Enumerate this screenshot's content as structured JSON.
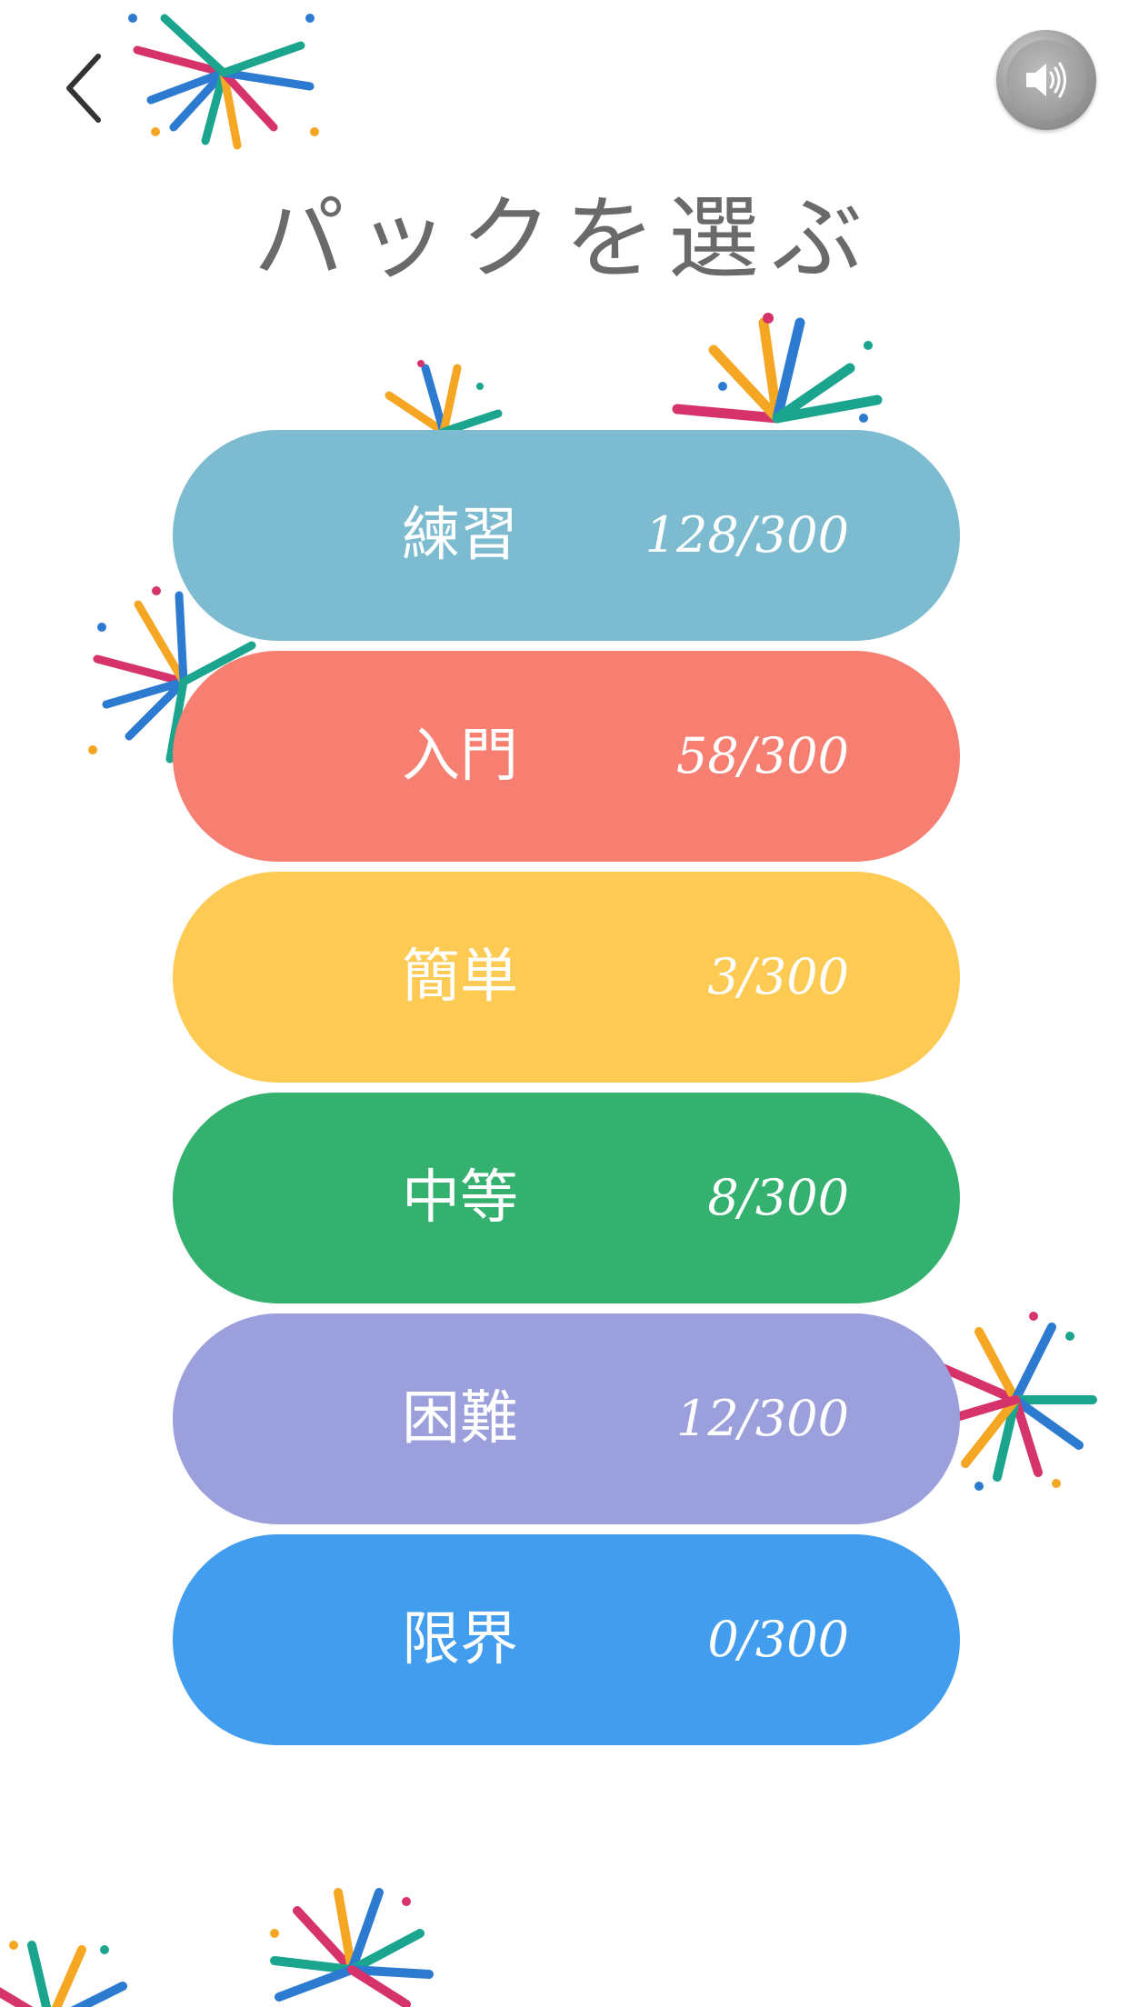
{
  "header": {
    "back_icon": "chevron-left-icon",
    "sound_icon": "speaker-icon",
    "title": "パックを選ぶ"
  },
  "packs": [
    {
      "name": "練習",
      "progress": "128/300",
      "color": "#7DBCD0"
    },
    {
      "name": "入門",
      "progress": "58/300",
      "color": "#F77F72"
    },
    {
      "name": "簡単",
      "progress": "3/300",
      "color": "#FDCA53"
    },
    {
      "name": "中等",
      "progress": "8/300",
      "color": "#34B16F"
    },
    {
      "name": "困難",
      "progress": "12/300",
      "color": "#9B9FDC"
    },
    {
      "name": "限界",
      "progress": "0/300",
      "color": "#429DEE"
    }
  ],
  "decor": {
    "icon": "firework-icon",
    "colors": [
      "#D6336C",
      "#2C7BD1",
      "#1BA58F",
      "#F5A623"
    ]
  }
}
